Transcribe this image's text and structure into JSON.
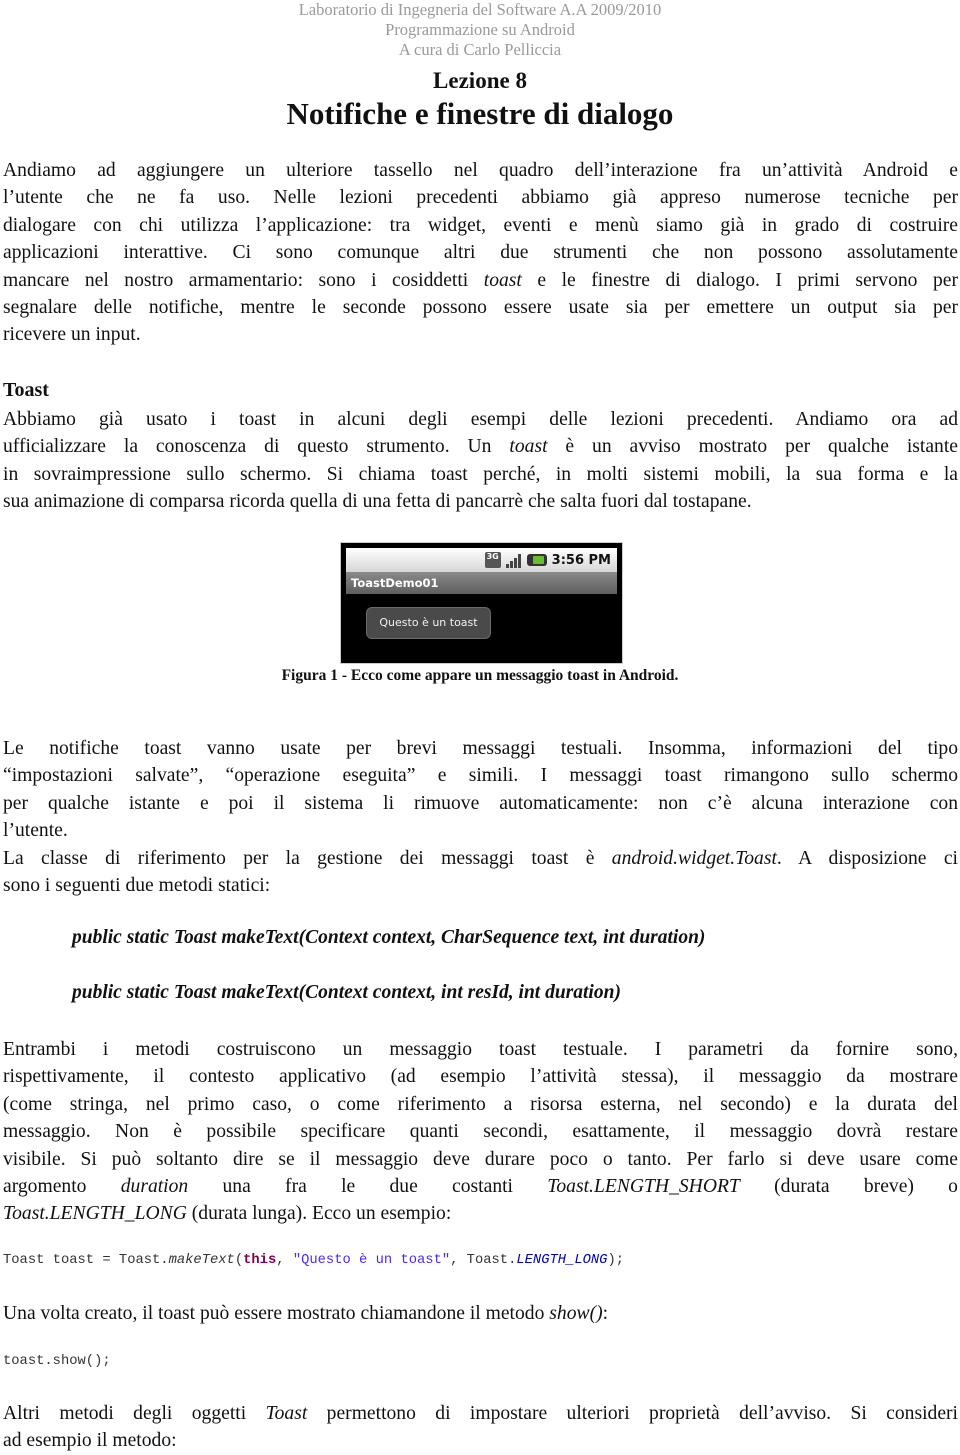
{
  "header": {
    "line1": "Laboratorio di Ingegneria del Software A.A 2009/2010",
    "line2": "Programmazione su Android",
    "line3": "A cura di Carlo Pelliccia"
  },
  "lesson": {
    "number_label": "Lezione 8",
    "title": "Notifiche e finestre di dialogo"
  },
  "intro": {
    "lines": [
      "Andiamo ad aggiungere un ulteriore tassello nel quadro dell’interazione fra un’attività Android e",
      "l’utente che ne fa uso. Nelle lezioni precedenti abbiamo già appreso numerose tecniche per",
      "dialogare con chi utilizza l’applicazione: tra widget, eventi e menù siamo già in grado di costruire",
      "applicazioni interattive. Ci sono comunque altri due strumenti che non possono assolutamente"
    ],
    "line5_before": "mancare nel nostro armamentario: sono i cosiddetti ",
    "line5_em": "toast",
    "line5_after": " e le finestre di dialogo. I primi servono per",
    "line6": "segnalare delle notifiche, mentre le seconde possono essere usate sia per emettere un output sia per",
    "line7": "ricevere un input."
  },
  "toast_section": {
    "title": "Toast",
    "line1": "Abbiamo già usato i toast in alcuni degli esempi delle lezioni precedenti. Andiamo ora ad",
    "line2_before": "ufficializzare la conoscenza di questo strumento. Un ",
    "line2_em": "toast",
    "line2_after": " è un avviso mostrato per qualche istante",
    "line3": "in sovraimpressione sullo schermo. Si chiama toast perché, in molti sistemi mobili, la sua forma e la",
    "line4": "sua animazione di comparsa ricorda quella di una fetta di pancarrè che salta fuori dal tostapane."
  },
  "figure": {
    "status_time": "3:56 PM",
    "status_icons": [
      "3g-icon",
      "signal-icon",
      "battery-icon"
    ],
    "network_label": "3G",
    "app_title": "ToastDemo01",
    "toast_text": "Questo è un toast",
    "caption": "Figura 1 - Ecco come appare un messaggio toast in Android."
  },
  "notes": {
    "lines": [
      "Le notifiche toast vanno usate per brevi messaggi testuali. Insomma, informazioni del tipo",
      "“impostazioni salvate”, “operazione eseguita” e simili. I messaggi toast rimangono sullo schermo",
      "per qualche istante e poi il sistema li rimuove automaticamente: non c’è alcuna interazione con",
      "l’utente."
    ],
    "class_before": "La classe di riferimento per la gestione dei messaggi toast è ",
    "class_em": "android.widget.Toast",
    "class_after": ". A disposizione ci",
    "class_line2": "sono i seguenti due metodi statici:"
  },
  "signatures": [
    "public static Toast makeText(Context context, CharSequence text, int duration)",
    "public static Toast makeText(Context context, int resId, int duration)"
  ],
  "params": {
    "lines": [
      "Entrambi i metodi costruiscono un messaggio toast testuale. I parametri da fornire sono,",
      "rispettivamente, il contesto applicativo (ad esempio l’attività stessa), il messaggio da mostrare",
      "(come stringa, nel primo caso, o come riferimento a risorsa esterna, nel secondo) e la durata del",
      "messaggio. Non è possibile specificare quanti secondi, esattamente, il messaggio dovrà restare",
      "visibile. Si può soltanto dire se il messaggio deve durare poco o tanto. Per farlo si deve usare come"
    ],
    "l6_a": "argomento ",
    "l6_em1": "duration",
    "l6_b": " una fra le due costanti ",
    "l6_em2": "Toast.LENGTH_SHORT",
    "l6_c": " (durata breve) o",
    "l7_em": "Toast.LENGTH_LONG",
    "l7_after": " (durata lunga). Ecco un esempio:"
  },
  "code1": {
    "p1": "Toast toast = Toast.",
    "fn": "makeText",
    "p2": "(",
    "kw": "this",
    "p3": ", ",
    "str": "\"Questo è un toast\"",
    "p4": ", Toast.",
    "const": "LENGTH_LONG",
    "p5": ");"
  },
  "show_para": {
    "before": "Una volta creato, il toast può essere mostrato chiamandone il metodo ",
    "em": "show()",
    "after": ":"
  },
  "code2": "toast.show();",
  "final_para": {
    "before": "Altri metodi degli oggetti ",
    "em": "Toast",
    "after": " permettono di impostare ulteriori proprietà dell’avviso. Si consideri",
    "line2": "ad esempio il metodo:"
  }
}
